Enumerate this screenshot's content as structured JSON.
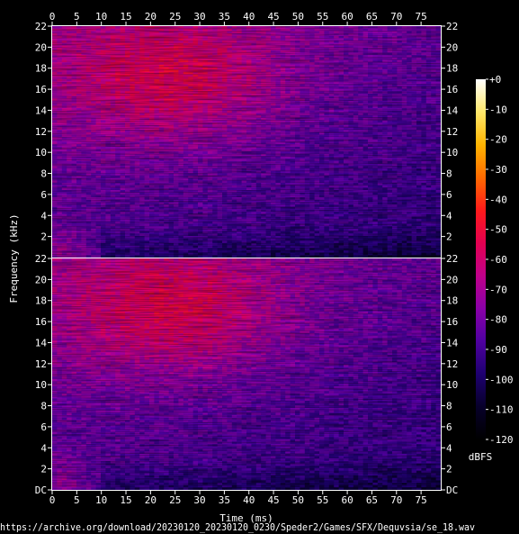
{
  "chart_data": {
    "type": "heatmap",
    "xlabel": "Time (ms)",
    "ylabel": "Frequency (kHz)",
    "xlim": [
      0,
      79
    ],
    "x_ticks": [
      0,
      5,
      10,
      15,
      20,
      25,
      30,
      35,
      40,
      45,
      50,
      55,
      60,
      65,
      70,
      75
    ],
    "channels": [
      {
        "ylim": [
          0,
          22
        ],
        "y_ticks": [
          2,
          4,
          6,
          8,
          10,
          12,
          14,
          16,
          18,
          20,
          22
        ],
        "y_tick_labels": [
          "2",
          "4",
          "6",
          "8",
          "10",
          "12",
          "14",
          "16",
          "18",
          "20",
          "22"
        ]
      },
      {
        "ylim": [
          0,
          22
        ],
        "y_ticks": [
          0,
          2,
          4,
          6,
          8,
          10,
          12,
          14,
          16,
          18,
          20,
          22
        ],
        "y_tick_labels": [
          "DC",
          "2",
          "4",
          "6",
          "8",
          "10",
          "12",
          "14",
          "16",
          "18",
          "20",
          "22"
        ]
      }
    ],
    "colorbar": {
      "label": "dBFS",
      "range": [
        -120,
        0
      ],
      "ticks": [
        0,
        -10,
        -20,
        -30,
        -40,
        -50,
        -60,
        -70,
        -80,
        -90,
        -100,
        -110,
        -120
      ],
      "tick_labels": [
        "+0",
        "-10",
        "-20",
        "-30",
        "-40",
        "-50",
        "-60",
        "-70",
        "-80",
        "-90",
        "-100",
        "-110",
        "-120"
      ],
      "colors": [
        "#000000",
        "#07002a",
        "#1e0070",
        "#4f00a0",
        "#8a00a8",
        "#c0008a",
        "#e40050",
        "#ff1a1a",
        "#ff6a00",
        "#ffb400",
        "#ffe86a",
        "#ffffff"
      ]
    },
    "energy_peak_band": {
      "time_ms": [
        10,
        40
      ],
      "freq_khz": [
        12,
        22
      ],
      "level_dbfs": -55
    }
  },
  "footer": {
    "source_url": "https://archive.org/download/20230120_20230120_0230/Speder2/Games/SFX/Dequvsia/se_18.wav"
  }
}
